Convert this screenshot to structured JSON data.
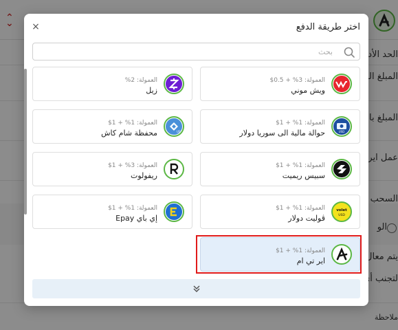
{
  "background": {
    "row_texts": [
      "الحد الأدنى",
      "المبلغ المست",
      "المبلغ بالدولار",
      "عمل اير تي ام",
      "السحب عن",
      "الو",
      "يتم معال",
      "لتجنب أي",
      "ملاحظة"
    ]
  },
  "modal": {
    "title": "اختر طريقة الدفع",
    "close_symbol": "×",
    "search": {
      "placeholder": "بحث",
      "value": ""
    },
    "load_more_symbol": "»"
  },
  "payment_methods": [
    {
      "name": "ويش موني",
      "commission": "العمولة: 3% + 0.5$",
      "icon": "wish-money-icon"
    },
    {
      "name": "زيل",
      "commission": "العمولة: 2%",
      "icon": "zelle-icon"
    },
    {
      "name": "حوالة مالية الى سوريا دولار",
      "commission": "العمولة: 1% + 1$",
      "icon": "transfer-syria-icon"
    },
    {
      "name": "محفظة شام كاش",
      "commission": "العمولة: 1% + 1$",
      "icon": "sham-cash-icon"
    },
    {
      "name": "سبيس ريميت",
      "commission": "العمولة: 1% + 1$",
      "icon": "space-remit-icon"
    },
    {
      "name": "ريفولوت",
      "commission": "العمولة: 3% + 1$",
      "icon": "revolut-icon"
    },
    {
      "name": "ڤوليت دولار",
      "commission": "العمولة: 1% + 1$",
      "icon": "volet-icon"
    },
    {
      "name": "إي باي Epay",
      "commission": "العمولة: 1% + 1$",
      "icon": "epay-icon"
    },
    {
      "name": "اير تي ام",
      "commission": "العمولة: 1% + 1$",
      "icon": "airtm-icon",
      "selected": true
    }
  ],
  "colors": {
    "accent_green": "#5bb744",
    "selected_bg": "#e3eefa",
    "selection_outline": "#e01a1a",
    "load_more_bg": "#e7f0f8"
  }
}
